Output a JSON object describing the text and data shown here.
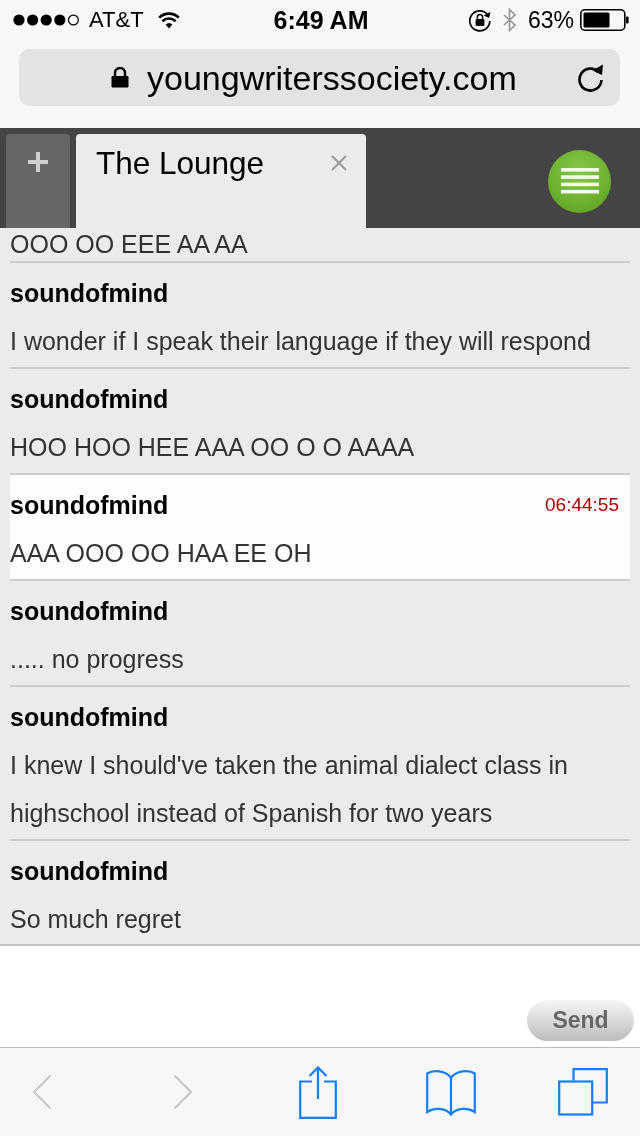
{
  "status_bar": {
    "carrier": "AT&T",
    "time": "6:49 AM",
    "battery": "63%"
  },
  "address_bar": {
    "url": "youngwriterssociety.com"
  },
  "tabs": [
    {
      "label": "The Lounge",
      "selected": true
    }
  ],
  "chat": {
    "messages": [
      {
        "text": "OOO OO EEE AA AA",
        "highlighted": false
      },
      {
        "author": "soundofmind",
        "text": "I wonder if I speak their language if they will respond",
        "highlighted": false
      },
      {
        "author": "soundofmind",
        "text": "HOO HOO HEE AAA OO O O AAAA",
        "highlighted": false
      },
      {
        "author": "soundofmind",
        "time": "06:44:55",
        "text": "AAA OOO OO HAA EE OH",
        "highlighted": true
      },
      {
        "author": "soundofmind",
        "text": "..... no progress",
        "highlighted": false
      },
      {
        "author": "soundofmind",
        "text": "I knew I should've taken the animal dialect class in highschool instead of Spanish for two years",
        "highlighted": false
      },
      {
        "author": "soundofmind",
        "text": "So much regret",
        "highlighted": false
      }
    ]
  },
  "composer": {
    "send_button": "Send"
  },
  "toolbar": [
    {
      "kind": "back",
      "disabled": true
    },
    {
      "kind": "forward",
      "disabled": true
    },
    {
      "kind": "share",
      "disabled": false
    },
    {
      "kind": "bookmarks",
      "disabled": false
    },
    {
      "kind": "tabs",
      "disabled": false
    }
  ]
}
